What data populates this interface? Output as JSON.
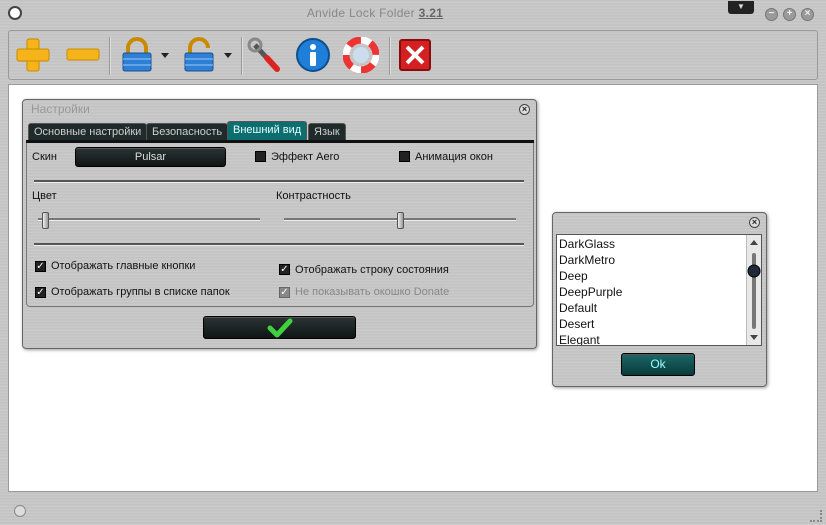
{
  "window": {
    "title_prefix": "Anvide Lock Folder ",
    "title_version": "3.21",
    "menu_glyph": "▼",
    "min_glyph": "−",
    "max_glyph": "+",
    "close_glyph": "×"
  },
  "toolbar": {
    "icons": [
      "add-icon",
      "remove-icon",
      "lock-icon",
      "unlock-icon",
      "settings-icon",
      "info-icon",
      "help-icon",
      "exit-icon"
    ]
  },
  "settings": {
    "title": "Настройки",
    "tabs": [
      "Основные настройки",
      "Безопасность",
      "Внешний вид",
      "Язык"
    ],
    "skin_label": "Скин",
    "skin_value": "Pulsar",
    "aero_label": "Эффект Aero",
    "anim_label": "Анимация окон",
    "color_label": "Цвет",
    "contrast_label": "Контрастность",
    "color_level": 0.02,
    "contrast_level": 0.5,
    "show_buttons_label": "Отображать главные кнопки",
    "show_groups_label": "Отображать группы в списке папок",
    "show_status_label": "Отображать строку состояния",
    "no_donate_label": "Не показывать окошко Donate",
    "check_glyph": "✓",
    "ok_icon": "checkmark-icon"
  },
  "skin_list": {
    "items": [
      "DarkGlass",
      "DarkMetro",
      "Deep",
      "DeepPurple",
      "Default",
      "Desert",
      "Elegant"
    ],
    "ok_label": "Ok"
  },
  "colors": {
    "accent": "#0d6e6f",
    "active_tab": "#0d6e6f"
  }
}
